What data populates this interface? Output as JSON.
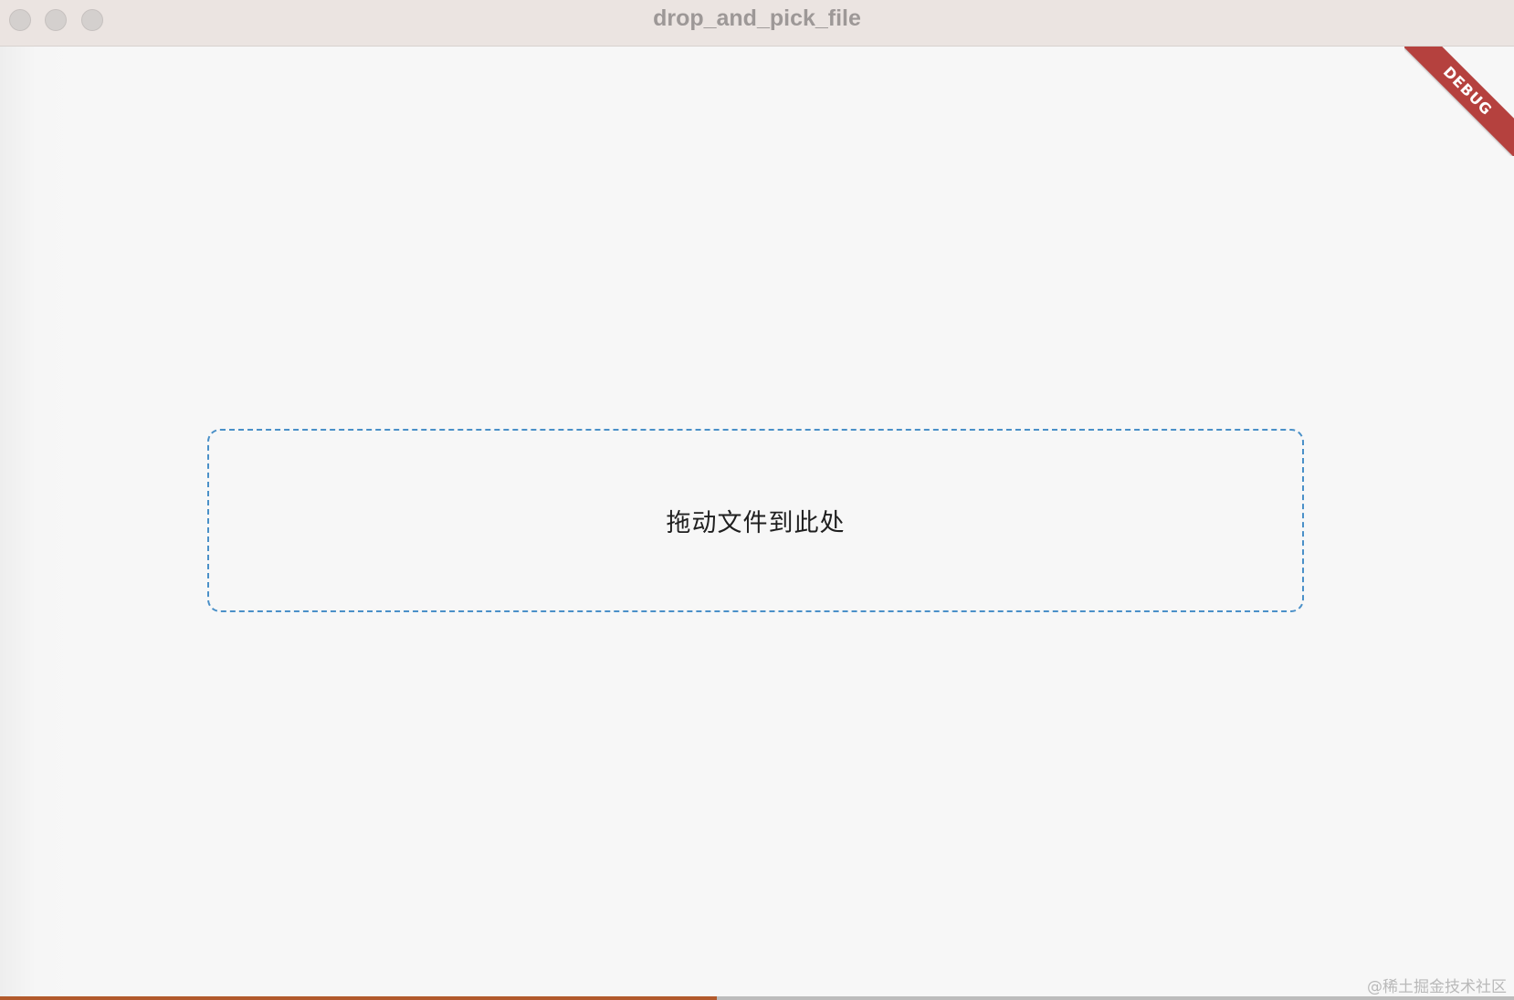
{
  "window": {
    "title": "drop_and_pick_file",
    "traffic_lights": [
      "close",
      "minimize",
      "zoom"
    ]
  },
  "dropzone": {
    "label": "拖动文件到此处",
    "border_color": "#4a90c8"
  },
  "debug_banner": {
    "label": "DEBUG",
    "color": "#b5413e"
  },
  "watermark": {
    "text": "@稀土掘金技术社区"
  }
}
